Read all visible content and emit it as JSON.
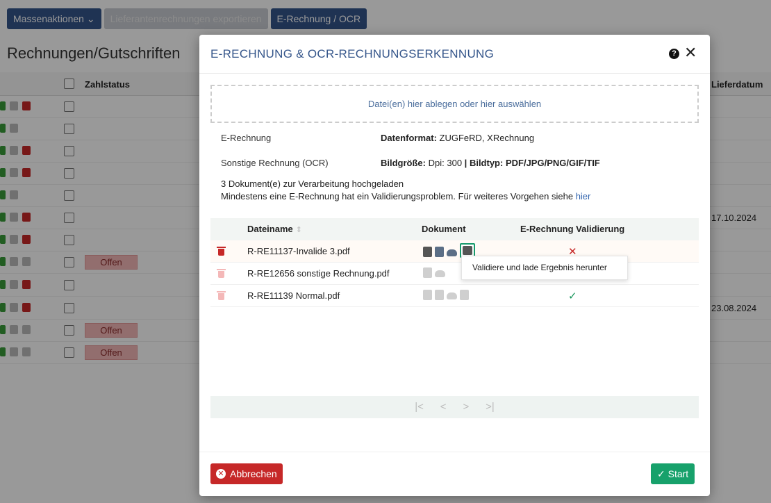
{
  "toolbar": {
    "mass_actions": "Massenaktionen",
    "export_label": "Lieferantenrechnungen exportieren",
    "erechnung_label": "E-Rechnung / OCR"
  },
  "page": {
    "title": "Rechnungen/Gutschriften",
    "col_zahlstatus": "Zahlstatus",
    "col_lieferdatum": "Lieferdatum",
    "status_offen": "Offen",
    "dates": [
      "17.10.2024",
      "23.08.2024"
    ]
  },
  "modal": {
    "title": "E-RECHNUNG & OCR-RECHNUNGSERKENNUNG",
    "help_glyph": "?",
    "close_glyph": "✕",
    "dropzone": "Datei(en) hier ablegen oder hier auswählen",
    "erechnung_label": "E-Rechnung",
    "datenformat_label": "Datenformat:",
    "datenformat_value": "ZUGFeRD, XRechnung",
    "ocr_label": "Sonstige Rechnung (OCR)",
    "bildgroesse_label": "Bildgröße:",
    "bildgroesse_value": "Dpi: 300",
    "separator": "|",
    "bildtyp_label": "Bildtyp:",
    "bildtyp_value": "PDF/JPG/PNG/GIF/TIF",
    "uploaded_msg": "3 Dokument(e) zur Verarbeitung hochgeladen",
    "validation_msg": "Mindestens eine E-Rechnung hat ein Validierungsproblem. Für weiteres Vorgehen siehe",
    "validation_link": "hier",
    "table": {
      "col_filename": "Dateiname",
      "col_document": "Dokument",
      "col_validation": "E-Rechnung Validierung",
      "rows": [
        {
          "filename": "R-RE11137-Invalide 3.pdf",
          "status": "✕"
        },
        {
          "filename": "R-RE12656 sonstige Rechnung.pdf",
          "status": ""
        },
        {
          "filename": "R-RE11139 Normal.pdf",
          "status": "✓"
        }
      ]
    },
    "tooltip": "Validiere und lade Ergebnis herunter",
    "pager": {
      "first": "|<",
      "prev": "<",
      "next": ">",
      "last": ">|"
    },
    "cancel_label": "Abbrechen",
    "start_label": "Start",
    "icons": {
      "help": "help-icon",
      "close": "close-icon",
      "trash": "trash-icon",
      "view": "view-icon",
      "xml": "xml-file-icon",
      "cloud": "cloud-download-icon",
      "validate": "validate-download-icon",
      "sort": "sort-icon",
      "check": "check-icon"
    },
    "colors": {
      "primary": "#34558a",
      "danger": "#c62828",
      "success": "#17a16b"
    }
  }
}
